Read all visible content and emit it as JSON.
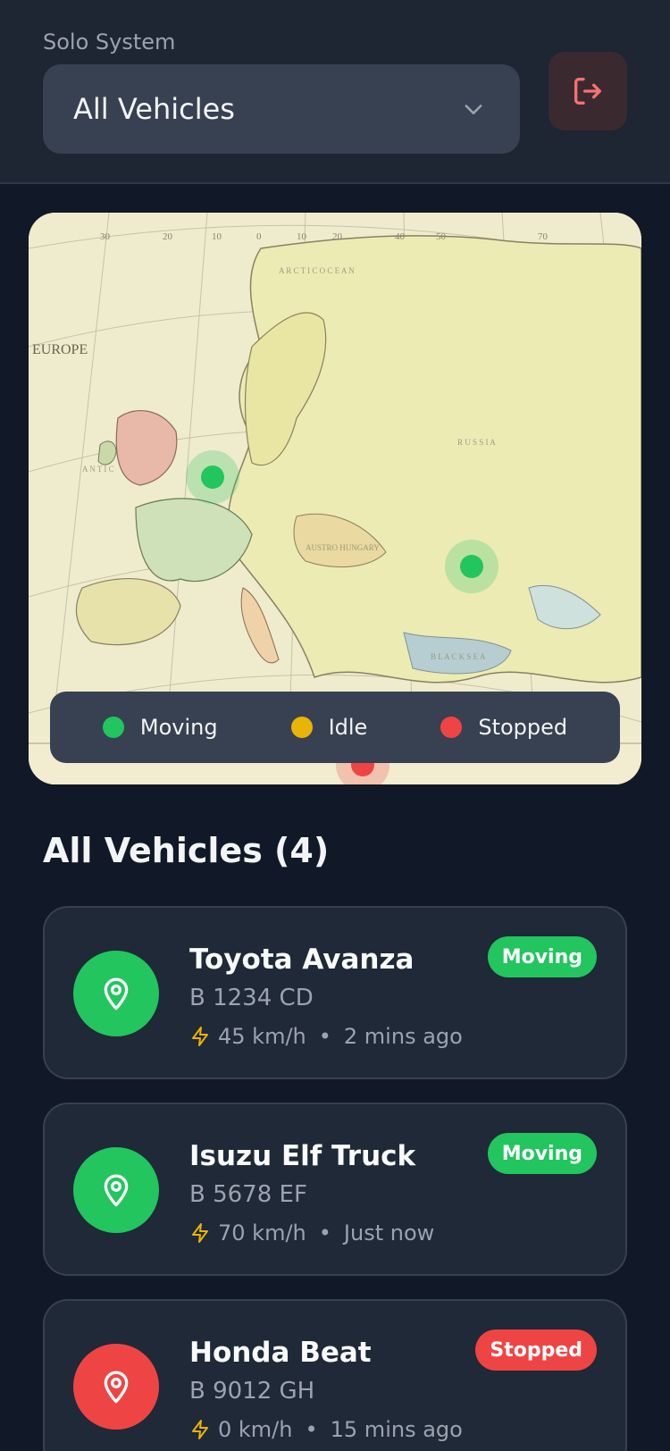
{
  "header": {
    "system_label": "Solo System",
    "selected_vehicle": "All Vehicles",
    "logout_icon": "logout-icon"
  },
  "map": {
    "legend": [
      {
        "label": "Moving",
        "color": "#22c55e"
      },
      {
        "label": "Idle",
        "color": "#eab308"
      },
      {
        "label": "Stopped",
        "color": "#ef4444"
      }
    ]
  },
  "list": {
    "title": "All Vehicles (4)",
    "vehicles": [
      {
        "name": "Toyota Avanza",
        "plate": "B 1234 CD",
        "speed": "45 km/h",
        "updated": "2 mins ago",
        "status": "Moving",
        "status_color": "#22c55e"
      },
      {
        "name": "Isuzu Elf Truck",
        "plate": "B 5678 EF",
        "speed": "70 km/h",
        "updated": "Just now",
        "status": "Moving",
        "status_color": "#22c55e"
      },
      {
        "name": "Honda Beat",
        "plate": "B 9012 GH",
        "speed": "0 km/h",
        "updated": "15 mins ago",
        "status": "Stopped",
        "status_color": "#ef4444"
      }
    ],
    "separator": "•"
  },
  "colors": {
    "background": "#111827",
    "card": "#1f2937",
    "accent_red": "#ef4444",
    "speed_icon": "#eab308"
  }
}
